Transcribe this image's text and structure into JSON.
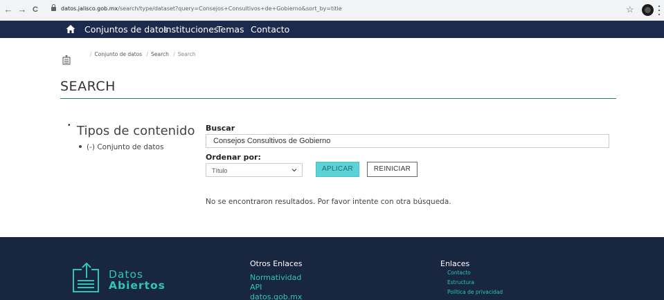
{
  "browser": {
    "back": "←",
    "forward": "→",
    "reload": "C",
    "url_host": "datos.jalisco.gob.mx",
    "url_path": "/search/type/dataset?query=Consejos+Consultivos+de+Gobierno&sort_by=title",
    "star": "☆"
  },
  "nav": {
    "items": [
      "Conjuntos de datos",
      "Instituciones",
      "Temas",
      "Contacto"
    ]
  },
  "breadcrumb": {
    "items": [
      "Conjunto de datos",
      "Search",
      "Search"
    ]
  },
  "page": {
    "title": "SEARCH"
  },
  "facets": {
    "title": "Tipos de contenido",
    "items": [
      "(-) Conjunto de datos"
    ]
  },
  "search": {
    "label": "Buscar",
    "value": "Consejos Consultivos de Gobierno",
    "sort_label": "Ordenar por:",
    "sort_value": "Título",
    "apply_label": "APLICAR",
    "reset_label": "REINICIAR",
    "no_results": "No se encontraron resultados. Por favor intente con otra búsqueda."
  },
  "footer": {
    "logo_line1": "Datos",
    "logo_line2": "Abiertos",
    "otros_heading": "Otros Enlaces",
    "otros_links": [
      "Normatividad",
      "API",
      "datos.gob.mx"
    ],
    "enlaces_heading": "Enlaces",
    "enlaces_links": [
      "Contacto",
      "Estructura",
      "Política de privacidad"
    ]
  },
  "colors": {
    "nav_bg": "#1c2b4d",
    "footer_bg": "#18263f",
    "accent_teal": "#2fc5b7",
    "apply_button": "#5bd2d6",
    "title_rule": "#2e7d5b"
  }
}
